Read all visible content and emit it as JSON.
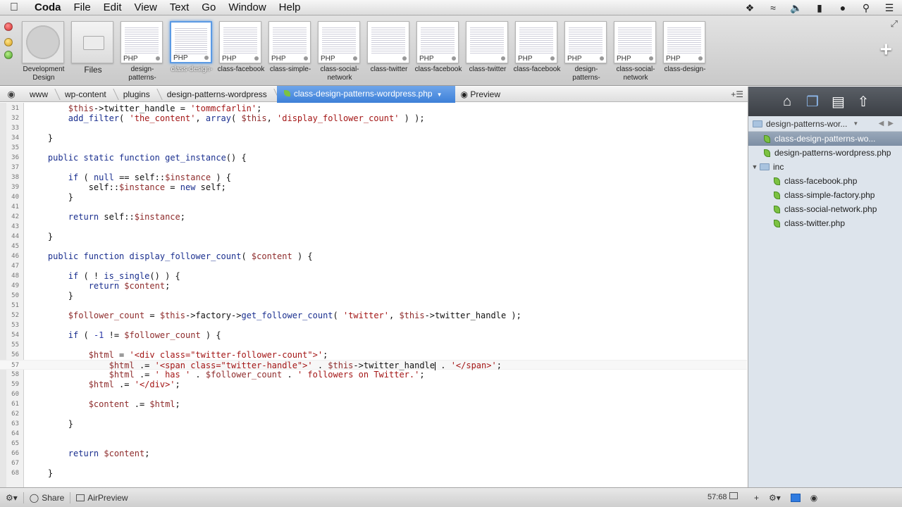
{
  "menubar": {
    "app": "Coda",
    "items": [
      "File",
      "Edit",
      "View",
      "Text",
      "Go",
      "Window",
      "Help"
    ]
  },
  "sites": [
    {
      "caption": "Development Design",
      "kind": "globe"
    },
    {
      "caption": "Files",
      "kind": "files"
    },
    {
      "caption": "design-patterns-",
      "tag": "PHP"
    },
    {
      "caption": "class-design-",
      "tag": "PHP",
      "active": true
    },
    {
      "caption": "class-facebook",
      "tag": "PHP"
    },
    {
      "caption": "class-simple-",
      "tag": "PHP"
    },
    {
      "caption": "class-social-network",
      "tag": "PHP"
    },
    {
      "caption": "class-twitter",
      "tag": ""
    },
    {
      "caption": "class-facebook",
      "tag": "PHP"
    },
    {
      "caption": "class-twitter",
      "tag": ""
    },
    {
      "caption": "class-facebook",
      "tag": "PHP"
    },
    {
      "caption": "design-patterns-",
      "tag": "PHP"
    },
    {
      "caption": "class-social-network",
      "tag": "PHP"
    },
    {
      "caption": "class-design-",
      "tag": "PHP"
    }
  ],
  "breadcrumb": {
    "items": [
      "www",
      "wp-content",
      "plugins",
      "design-patterns-wordpress"
    ],
    "current": "class-design-patterns-wordpress.php",
    "preview": "Preview"
  },
  "editor": {
    "current_line": 57,
    "lines": [
      {
        "n": "31",
        "html": "        <span class='var'>$this</span>->twitter_handle = <span class='str'>'tommcfarlin'</span>;"
      },
      {
        "n": "32",
        "html": "        <span class='fn'>add_filter</span>( <span class='str'>'the_content'</span>, <span class='fn'>array</span>( <span class='var'>$this</span>, <span class='str'>'display_follower_count'</span> ) );"
      },
      {
        "n": "33",
        "html": ""
      },
      {
        "n": "34",
        "html": "    }"
      },
      {
        "n": "35",
        "html": ""
      },
      {
        "n": "36",
        "html": "    <span class='kw'>public static function</span> <span class='fn'>get_instance</span>() {"
      },
      {
        "n": "37",
        "html": ""
      },
      {
        "n": "38",
        "html": "        <span class='kw'>if</span> ( <span class='kw'>null</span> == self::<span class='var'>$instance</span> ) {"
      },
      {
        "n": "39",
        "html": "            self::<span class='var'>$instance</span> = <span class='kw'>new</span> self;"
      },
      {
        "n": "40",
        "html": "        }"
      },
      {
        "n": "41",
        "html": ""
      },
      {
        "n": "42",
        "html": "        <span class='kw'>return</span> self::<span class='var'>$instance</span>;"
      },
      {
        "n": "43",
        "html": ""
      },
      {
        "n": "44",
        "html": "    }"
      },
      {
        "n": "45",
        "html": ""
      },
      {
        "n": "46",
        "html": "    <span class='kw'>public function</span> <span class='fn'>display_follower_count</span>( <span class='var'>$content</span> ) {"
      },
      {
        "n": "47",
        "html": ""
      },
      {
        "n": "48",
        "html": "        <span class='kw'>if</span> ( ! <span class='fn'>is_single</span>() ) {"
      },
      {
        "n": "49",
        "html": "            <span class='kw'>return</span> <span class='var'>$content</span>;"
      },
      {
        "n": "50",
        "html": "        }"
      },
      {
        "n": "51",
        "html": ""
      },
      {
        "n": "52",
        "html": "        <span class='var'>$follower_count</span> = <span class='var'>$this</span>->factory-><span class='fn'>get_follower_count</span>( <span class='str'>'twitter'</span>, <span class='var'>$this</span>->twitter_handle );"
      },
      {
        "n": "53",
        "html": ""
      },
      {
        "n": "54",
        "html": "        <span class='kw'>if</span> ( <span class='num'>-1</span> != <span class='var'>$follower_count</span> ) {"
      },
      {
        "n": "55",
        "html": ""
      },
      {
        "n": "56",
        "html": "            <span class='var'>$html</span> = <span class='str'>'&lt;div class=\"twitter-follower-count\"&gt;'</span>;"
      },
      {
        "n": "57",
        "html": "                <span class='var'>$html</span> .= <span class='str'>'&lt;span class=\"twitter-handle\"&gt;'</span> . <span class='var'>$this</span>->twitter_handle<span class='caret-mark'></span> . <span class='str'>'&lt;/span&gt;'</span>;"
      },
      {
        "n": "58",
        "html": "                <span class='var'>$html</span> .= <span class='str'>' has '</span> . <span class='var'>$follower_count</span> . <span class='str'>' followers on Twitter.'</span>;"
      },
      {
        "n": "59",
        "html": "            <span class='var'>$html</span> .= <span class='str'>'&lt;/div&gt;'</span>;"
      },
      {
        "n": "60",
        "html": ""
      },
      {
        "n": "61",
        "html": "            <span class='var'>$content</span> .= <span class='var'>$html</span>;"
      },
      {
        "n": "62",
        "html": ""
      },
      {
        "n": "63",
        "html": "        }"
      },
      {
        "n": "64",
        "html": ""
      },
      {
        "n": "65",
        "html": ""
      },
      {
        "n": "66",
        "html": "        <span class='kw'>return</span> <span class='var'>$content</span>;"
      },
      {
        "n": "67",
        "html": ""
      },
      {
        "n": "68",
        "html": "    }"
      }
    ]
  },
  "sidebar": {
    "path": "design-patterns-wor...",
    "tree": [
      {
        "label": "class-design-patterns-wo...",
        "type": "file",
        "indent": 0,
        "selected": true
      },
      {
        "label": "design-patterns-wordpress.php",
        "type": "file",
        "indent": 0
      },
      {
        "label": "inc",
        "type": "folder",
        "indent": 0
      },
      {
        "label": "class-facebook.php",
        "type": "file",
        "indent": 1
      },
      {
        "label": "class-simple-factory.php",
        "type": "file",
        "indent": 1
      },
      {
        "label": "class-social-network.php",
        "type": "file",
        "indent": 1
      },
      {
        "label": "class-twitter.php",
        "type": "file",
        "indent": 1
      }
    ]
  },
  "statusbar": {
    "share": "Share",
    "airpreview": "AirPreview",
    "position": "57:68"
  },
  "colors": {
    "accent": "#3d80d8",
    "sidebar_bg": "#dde4ec"
  }
}
